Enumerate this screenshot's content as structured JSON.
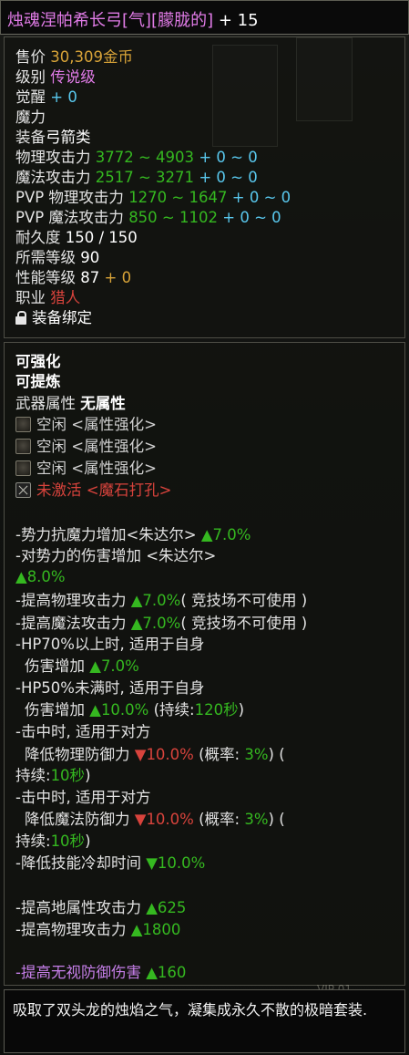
{
  "title": {
    "name": "烛魂涅帕希长弓[气][朦胧的]",
    "plus": "+ 15"
  },
  "basic": {
    "price_label": "售价",
    "price_value": "30,309金币",
    "grade_label": "级别",
    "grade_value": "传说级",
    "awaken_label": "觉醒",
    "awaken_value": "+ 0",
    "mana_label": "魔力",
    "equip_label": "装备",
    "equip_value": "弓箭类",
    "phys_label": "物理攻击力",
    "phys_value": "3772 ~ 4903",
    "phys_bonus": "+ 0 ~ 0",
    "mag_label": "魔法攻击力",
    "mag_value": "2517 ~ 3271",
    "mag_bonus": "+ 0 ~ 0",
    "pvp_phys_label": "PVP 物理攻击力",
    "pvp_phys_value": "1270 ~ 1647",
    "pvp_phys_bonus": "+ 0 ~ 0",
    "pvp_mag_label": "PVP 魔法攻击力",
    "pvp_mag_value": "850 ~ 1102",
    "pvp_mag_bonus": "+ 0 ~ 0",
    "dur_label": "耐久度",
    "dur_value": "150 / 150",
    "req_label": "所需等级",
    "req_value": "90",
    "perf_label": "性能等级",
    "perf_value": "87",
    "perf_bonus": "+ 0",
    "class_label": "职业",
    "class_value": "猎人",
    "bind_label": "装备绑定"
  },
  "enhance": {
    "can_enhance": "可强化",
    "can_refine": "可提炼",
    "attr_label": "武器属性",
    "attr_value": "无属性",
    "slots": [
      {
        "text": "空闲 <属性强化>"
      },
      {
        "text": "空闲 <属性强化>"
      },
      {
        "text": "空闲 <属性强化>"
      }
    ],
    "inactive_text": "未激活 <魔石打孔>"
  },
  "effects": {
    "e1a": "-势力抗魔力增加<朱达尔> ",
    "e1b": "▲7.0%",
    "e2a": "-对势力的伤害增加 <朱达尔>",
    "e2b": "▲8.0%",
    "e3a": "-提高物理攻击力 ",
    "e3b": "▲7.0%",
    "e3c": "( 竞技场不可使用 )",
    "e4a": "-提高魔法攻击力 ",
    "e4b": "▲7.0%",
    "e4c": "( 竞技场不可使用 )",
    "e5a": "-HP70%以上时, 适用于自身",
    "e5b": "伤害增加 ",
    "e5c": "▲7.0%",
    "e6a": "-HP50%未满时, 适用于自身",
    "e6b": "伤害增加 ",
    "e6c": "▲10.0%",
    "e6d": " (持续:",
    "e6e": "120秒",
    "e6f": ")",
    "e7a": "-击中时, 适用于对方",
    "e7b": "降低物理防御力 ",
    "e7c": "▼10.0%",
    "e7d": " (概率: ",
    "e7e": "3%",
    "e7f": ") (",
    "e7g": "持续:",
    "e7h": "10秒",
    "e7i": ")",
    "e8a": "-击中时, 适用于对方",
    "e8b": "降低魔法防御力 ",
    "e8c": "▼10.0%",
    "e8d": " (概率: ",
    "e8e": "3%",
    "e8f": ") (",
    "e8g": "持续:",
    "e8h": "10秒",
    "e8i": ")",
    "e9a": "-降低技能冷却时间 ",
    "e9b": "▼10.0%",
    "e10a": "-提高地属性攻击力 ",
    "e10b": "▲625",
    "e11a": "-提高物理攻击力 ",
    "e11b": "▲1800",
    "e12a": "-提高无视防御伤害 ",
    "e12b": "▲160"
  },
  "description": "吸取了双头龙的烛焰之气，凝集成永久不散的极暗套装.",
  "colors": {
    "legendary": "#e07be6",
    "green": "#35b820",
    "red": "#d8433c",
    "cyan": "#59c8ee",
    "gold": "#d8a338"
  }
}
